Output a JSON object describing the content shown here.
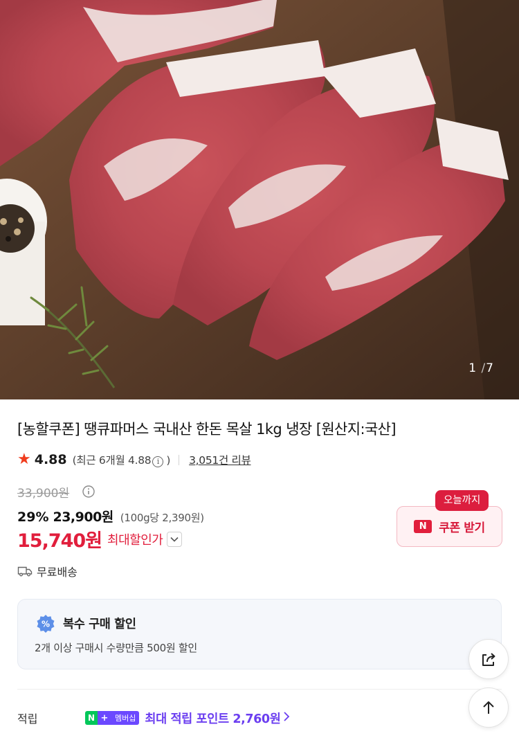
{
  "gallery": {
    "current": "1",
    "separator": "/",
    "total": "7",
    "image_alt_icon": "pork-neck-photo"
  },
  "product": {
    "title": "[농할쿠폰] 땡큐파머스 국내산 한돈 목살 1kg 냉장 [원산지:국산]",
    "rating_score": "4.88",
    "rating_recent_prefix": "(최근 6개월 4.88",
    "rating_recent_suffix": ")",
    "rating_info_glyph": "i",
    "review_count": "3,051건 리뷰"
  },
  "price": {
    "original": "33,900원",
    "discount_rate": "29%",
    "sale_price": "23,900원",
    "unit_price": "(100g당 2,390원)",
    "max_discount_price": "15,740원",
    "max_discount_label": "최대할인가"
  },
  "delivery": {
    "label": "무료배송",
    "icon": "truck-icon"
  },
  "coupon": {
    "badge": "오늘까지",
    "n_mark": "N",
    "button_label": "쿠폰 받기"
  },
  "multi_buy": {
    "icon_glyph": "%",
    "title": "복수 구매 할인",
    "description": "2개 이상 구매시 수량만큼 500원 할인"
  },
  "points": {
    "label": "적립",
    "badge_n": "N",
    "badge_plus": "+",
    "badge_membership": "멤버십",
    "text": "최대 적립 포인트 2,760원"
  },
  "colors": {
    "accent_red": "#e11e3c",
    "star": "#f03d1e",
    "points_purple": "#6b3ef0",
    "naver_green": "#03c75a"
  }
}
